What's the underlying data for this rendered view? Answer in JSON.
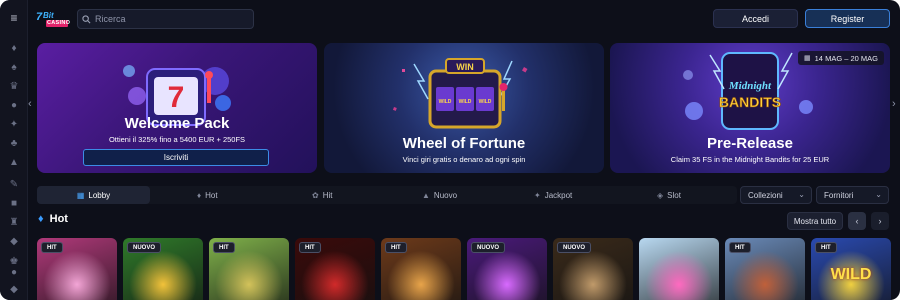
{
  "header": {
    "logo_text": "CASINO",
    "search_placeholder": "Ricerca",
    "login_label": "Accedi",
    "register_label": "Register"
  },
  "sidebar": {
    "icons": [
      "menu-icon",
      "flame-icon",
      "spade-icon",
      "crown-icon",
      "chip-icon",
      "dice-icon",
      "joystick-icon",
      "gift-icon",
      "trophy-icon",
      "star-icon",
      "card-icon",
      "ticket-icon",
      "cup-icon",
      "bag-icon",
      "diamond-icon"
    ]
  },
  "banners": [
    {
      "title": "Welcome Pack",
      "subtitle": "Ottieni il 325% fino a 5400 EUR + 250FS",
      "button_label": "Iscriviti"
    },
    {
      "title": "Wheel of Fortune",
      "subtitle": "Vinci giri gratis o denaro ad ogni spin",
      "art_text": "WIN",
      "reel_text": "WILD"
    },
    {
      "title": "Pre-Release",
      "subtitle": "Claim 35 FS in the Midnight Bandits for 25 EUR",
      "date_range": "14 MAG – 20 MAG",
      "art_text_top": "Midnight",
      "art_text_bottom": "BANDITS"
    }
  ],
  "tabs": [
    {
      "label": "Lobby",
      "icon": "lobby-icon",
      "active": true
    },
    {
      "label": "Hot",
      "icon": "flame-icon",
      "active": false
    },
    {
      "label": "Hit",
      "icon": "hit-icon",
      "active": false
    },
    {
      "label": "Nuovo",
      "icon": "rocket-icon",
      "active": false
    },
    {
      "label": "Jackpot",
      "icon": "jackpot-icon",
      "active": false
    },
    {
      "label": "Slot",
      "icon": "slot-icon",
      "active": false
    }
  ],
  "filters": {
    "collections_label": "Collezioni",
    "providers_label": "Fornitori"
  },
  "hot_section": {
    "title": "Hot",
    "show_all_label": "Mostra tutto",
    "prev_icon": "chevron-left-icon",
    "next_icon": "chevron-right-icon",
    "games": [
      {
        "badge": "HIT",
        "color": "#b0397a",
        "accent": "#f3a5d6"
      },
      {
        "badge": "NUOVO",
        "color": "#2f7a2a",
        "accent": "#f2c23a"
      },
      {
        "badge": "HIT",
        "color": "#7fb04a",
        "accent": "#d3c25a"
      },
      {
        "badge": "HIT",
        "color": "#3a0a0a",
        "accent": "#d12a2a"
      },
      {
        "badge": "HIT",
        "color": "#6d3a1a",
        "accent": "#e8a44a"
      },
      {
        "badge": "NUOVO",
        "color": "#4a1a7a",
        "accent": "#d86aff"
      },
      {
        "badge": "NUOVO",
        "color": "#3a2a1a",
        "accent": "#c09a6a"
      },
      {
        "badge": "",
        "color": "#b8d8f0",
        "accent": "#ff6ac0"
      },
      {
        "badge": "HIT",
        "color": "#6a8ab8",
        "accent": "#c0603a"
      },
      {
        "badge": "HIT",
        "color": "#2a4ab0",
        "accent": "#f0d040",
        "art_text": "WILD"
      }
    ]
  },
  "colors": {
    "background": "#0d0f19",
    "accent": "#3a7fd8"
  }
}
